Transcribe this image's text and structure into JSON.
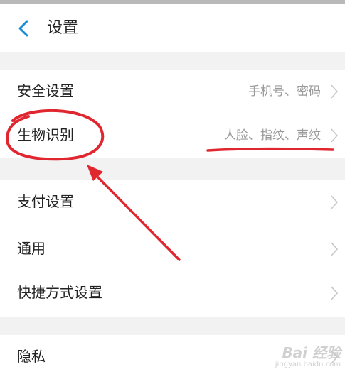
{
  "header": {
    "title": "设置",
    "back_icon": "chevron-left-icon"
  },
  "colors": {
    "accent": "#1b8ad2",
    "annotation": "#e0262e",
    "divider": "#f2f2f2"
  },
  "sections": [
    {
      "items": [
        {
          "label": "安全设置",
          "value": "手机号、密码"
        },
        {
          "label": "生物识别",
          "value": "人脸、指纹、声纹"
        }
      ]
    },
    {
      "items": [
        {
          "label": "支付设置",
          "value": ""
        },
        {
          "label": "通用",
          "value": ""
        },
        {
          "label": "快捷方式设置",
          "value": ""
        }
      ]
    },
    {
      "items": [
        {
          "label": "隐私",
          "value": ""
        }
      ]
    }
  ],
  "watermark": {
    "main": "Bai 经验",
    "sub": "jingyan.baidu.com"
  }
}
